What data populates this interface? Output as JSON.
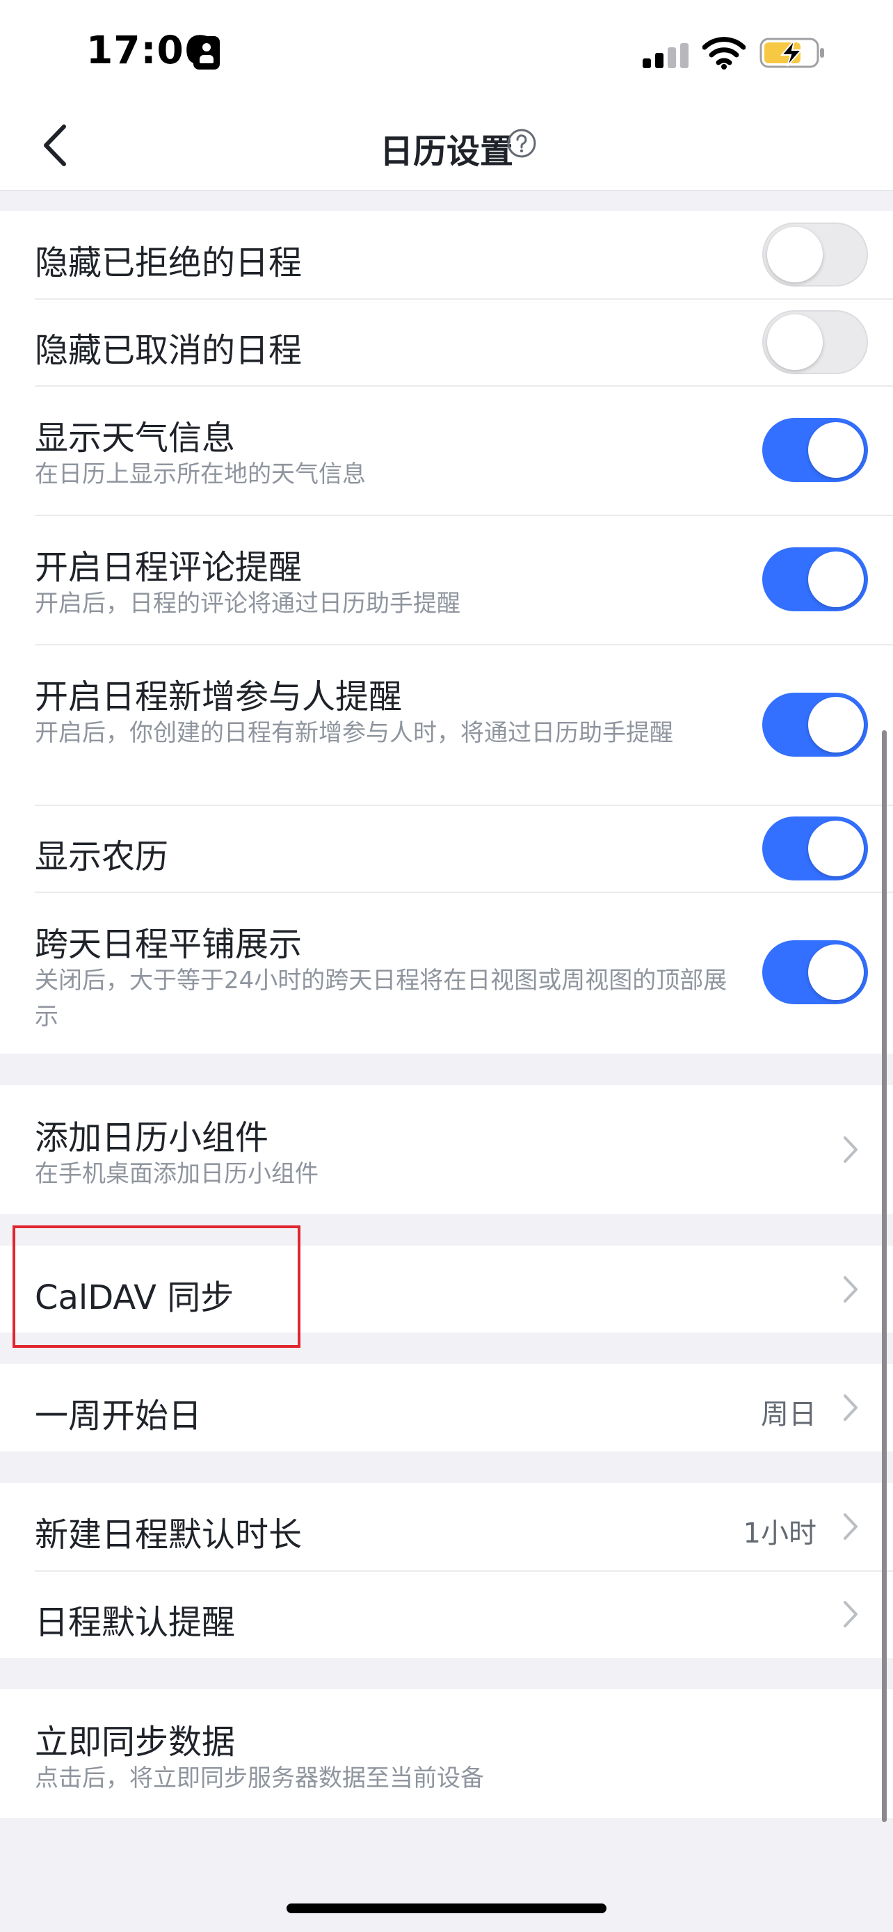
{
  "status_bar": {
    "time": "17:06"
  },
  "nav": {
    "title": "日历设置"
  },
  "group_toggles": [
    {
      "title": "隐藏已拒绝的日程",
      "state": "off"
    },
    {
      "title": "隐藏已取消的日程",
      "state": "off"
    },
    {
      "title": "显示天气信息",
      "desc": "在日历上显示所在地的天气信息",
      "state": "on"
    },
    {
      "title": "开启日程评论提醒",
      "desc": "开启后，日程的评论将通过日历助手提醒",
      "state": "on"
    },
    {
      "title": "开启日程新增参与人提醒",
      "desc": "开启后，你创建的日程有新增参与人时，将通过日历助手提醒",
      "state": "on"
    },
    {
      "title": "显示农历",
      "state": "on"
    },
    {
      "title": "跨天日程平铺展示",
      "desc": "关闭后，大于等于24小时的跨天日程将在日视图或周视图的顶部展示",
      "state": "on"
    }
  ],
  "widget": {
    "title": "添加日历小组件",
    "desc": "在手机桌面添加日历小组件"
  },
  "caldav": {
    "title": "CalDAV 同步"
  },
  "week_start": {
    "title": "一周开始日",
    "value": "周日"
  },
  "defaults": {
    "duration_title": "新建日程默认时长",
    "duration_value": "1小时",
    "reminder_title": "日程默认提醒"
  },
  "sync": {
    "title": "立即同步数据",
    "desc": "点击后，将立即同步服务器数据至当前设备"
  },
  "colors": {
    "accent": "#3370ff",
    "highlight": "#e0262f",
    "background": "#f1f1f6"
  }
}
